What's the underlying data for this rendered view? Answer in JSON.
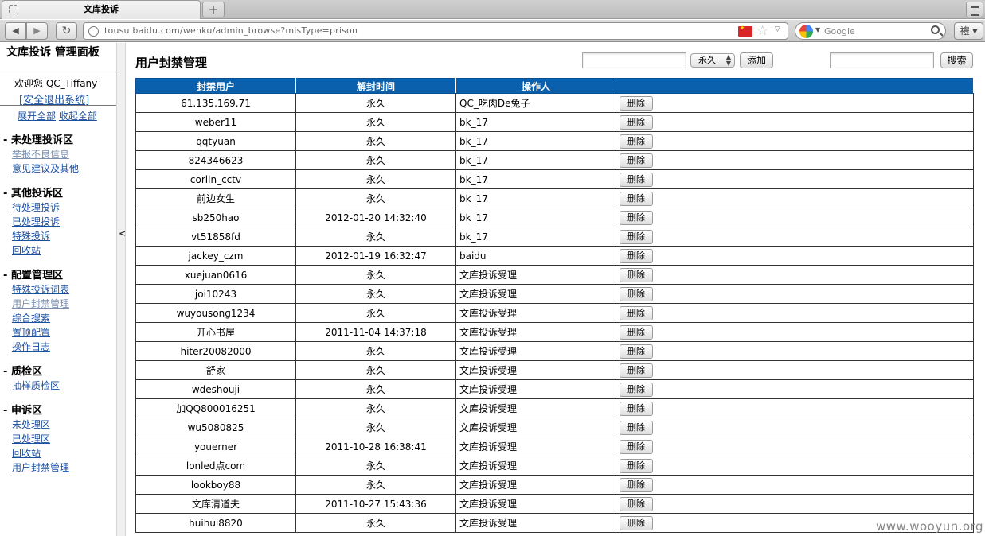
{
  "browser": {
    "tab_title": "文库投诉",
    "new_tab": "+",
    "url": "tousu.baidu.com/wenku/admin_browse?misType=prison",
    "search_engine": "Google",
    "addon_glyph": "禮"
  },
  "sidebar": {
    "title": "文库投诉 管理面板",
    "welcome": "欢迎您 QC_Tiffany",
    "logout": "[安全退出系统]",
    "expand_all": "展开全部",
    "collapse_all": "收起全部",
    "groups": [
      {
        "title": "未处理投诉区",
        "items": [
          "举报不良信息",
          "意见建议及其他"
        ]
      },
      {
        "title": "其他投诉区",
        "items": [
          "待处理投诉",
          "已处理投诉",
          "特殊投诉",
          "回收站"
        ]
      },
      {
        "title": "配置管理区",
        "items": [
          "特殊投诉词表",
          "用户封禁管理",
          "综合搜索",
          "置顶配置",
          "操作日志"
        ]
      },
      {
        "title": "质检区",
        "items": [
          "抽样质检区"
        ]
      },
      {
        "title": "申诉区",
        "items": [
          "未处理区",
          "已处理区",
          "回收站",
          "用户封禁管理"
        ]
      }
    ],
    "group_marker": "-",
    "collapse_arrow": "<"
  },
  "main": {
    "title": "用户封禁管理",
    "duration_select": "永久",
    "add_button": "添加",
    "search_button": "搜索",
    "table": {
      "headers": [
        "封禁用户",
        "解封时间",
        "操作人",
        ""
      ],
      "delete_label": "删除",
      "rows": [
        [
          "61.135.169.71",
          "永久",
          "QC_吃肉De兔子"
        ],
        [
          "weber11",
          "永久",
          "bk_17"
        ],
        [
          "qqtyuan",
          "永久",
          "bk_17"
        ],
        [
          "824346623",
          "永久",
          "bk_17"
        ],
        [
          "corlin_cctv",
          "永久",
          "bk_17"
        ],
        [
          "前边女生",
          "永久",
          "bk_17"
        ],
        [
          "sb250hao",
          "2012-01-20 14:32:40",
          "bk_17"
        ],
        [
          "vt51858fd",
          "永久",
          "bk_17"
        ],
        [
          "jackey_czm",
          "2012-01-19 16:32:47",
          "baidu"
        ],
        [
          "xuejuan0616",
          "永久",
          "文库投诉受理"
        ],
        [
          "joi10243",
          "永久",
          "文库投诉受理"
        ],
        [
          "wuyousong1234",
          "永久",
          "文库投诉受理"
        ],
        [
          "开心书屋",
          "2011-11-04 14:37:18",
          "文库投诉受理"
        ],
        [
          "hiter20082000",
          "永久",
          "文库投诉受理"
        ],
        [
          "舒家",
          "永久",
          "文库投诉受理"
        ],
        [
          "wdeshouji",
          "永久",
          "文库投诉受理"
        ],
        [
          "加QQ800016251",
          "永久",
          "文库投诉受理"
        ],
        [
          "wu5080825",
          "永久",
          "文库投诉受理"
        ],
        [
          "youerner",
          "2011-10-28 16:38:41",
          "文库投诉受理"
        ],
        [
          "lonled点com",
          "永久",
          "文库投诉受理"
        ],
        [
          "lookboy88",
          "永久",
          "文库投诉受理"
        ],
        [
          "文库清道夫",
          "2011-10-27 15:43:36",
          "文库投诉受理"
        ],
        [
          "huihui8820",
          "永久",
          "文库投诉受理"
        ]
      ]
    }
  },
  "watermark": "www.wooyun.org"
}
